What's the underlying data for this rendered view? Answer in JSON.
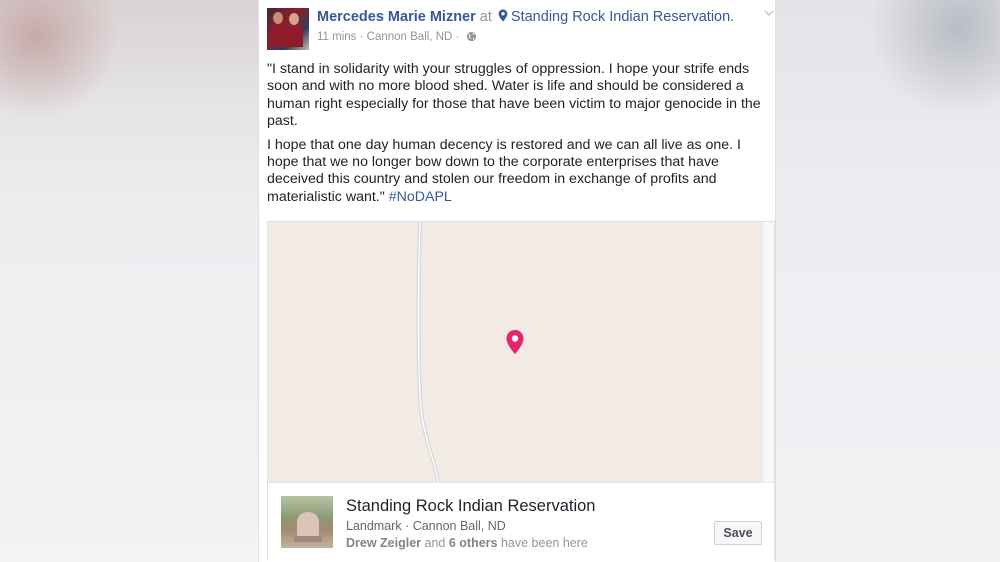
{
  "post": {
    "author": "Mercedes Marie Mizner",
    "at": "at",
    "location": "Standing Rock Indian Reservation.",
    "time": "11 mins",
    "separator": " · ",
    "place": "Cannon Ball, ND",
    "separator2": " · ",
    "paragraph1": "\"I stand in solidarity with your struggles of oppression. I hope your strife ends soon and with no more blood shed. Water is life and should be considered a human right especially for those that have been victim to major genocide in the past.",
    "paragraph2": "I hope that one day human decency is restored and we can all live as one. I hope that we no longer bow down to the corporate enterprises that have deceived this country and stolen our freedom in exchange of profits and materialistic want.\" ",
    "hashtag": "#NoDAPL"
  },
  "place_card": {
    "name": "Standing Rock Indian Reservation",
    "category": "Landmark",
    "separator": " · ",
    "city": "Cannon Ball, ND",
    "visitor_name": "Drew Zeigler",
    "visitor_and": " and ",
    "visitor_others": "6 others",
    "visitor_suffix": " have been here",
    "save_label": "Save"
  },
  "colors": {
    "link": "#365899",
    "map_pin": "#e8246f",
    "map_bg": "#f2ebe4"
  },
  "icons": [
    "location-pin-icon",
    "globe-icon",
    "chevron-down-icon",
    "map-marker-icon"
  ]
}
